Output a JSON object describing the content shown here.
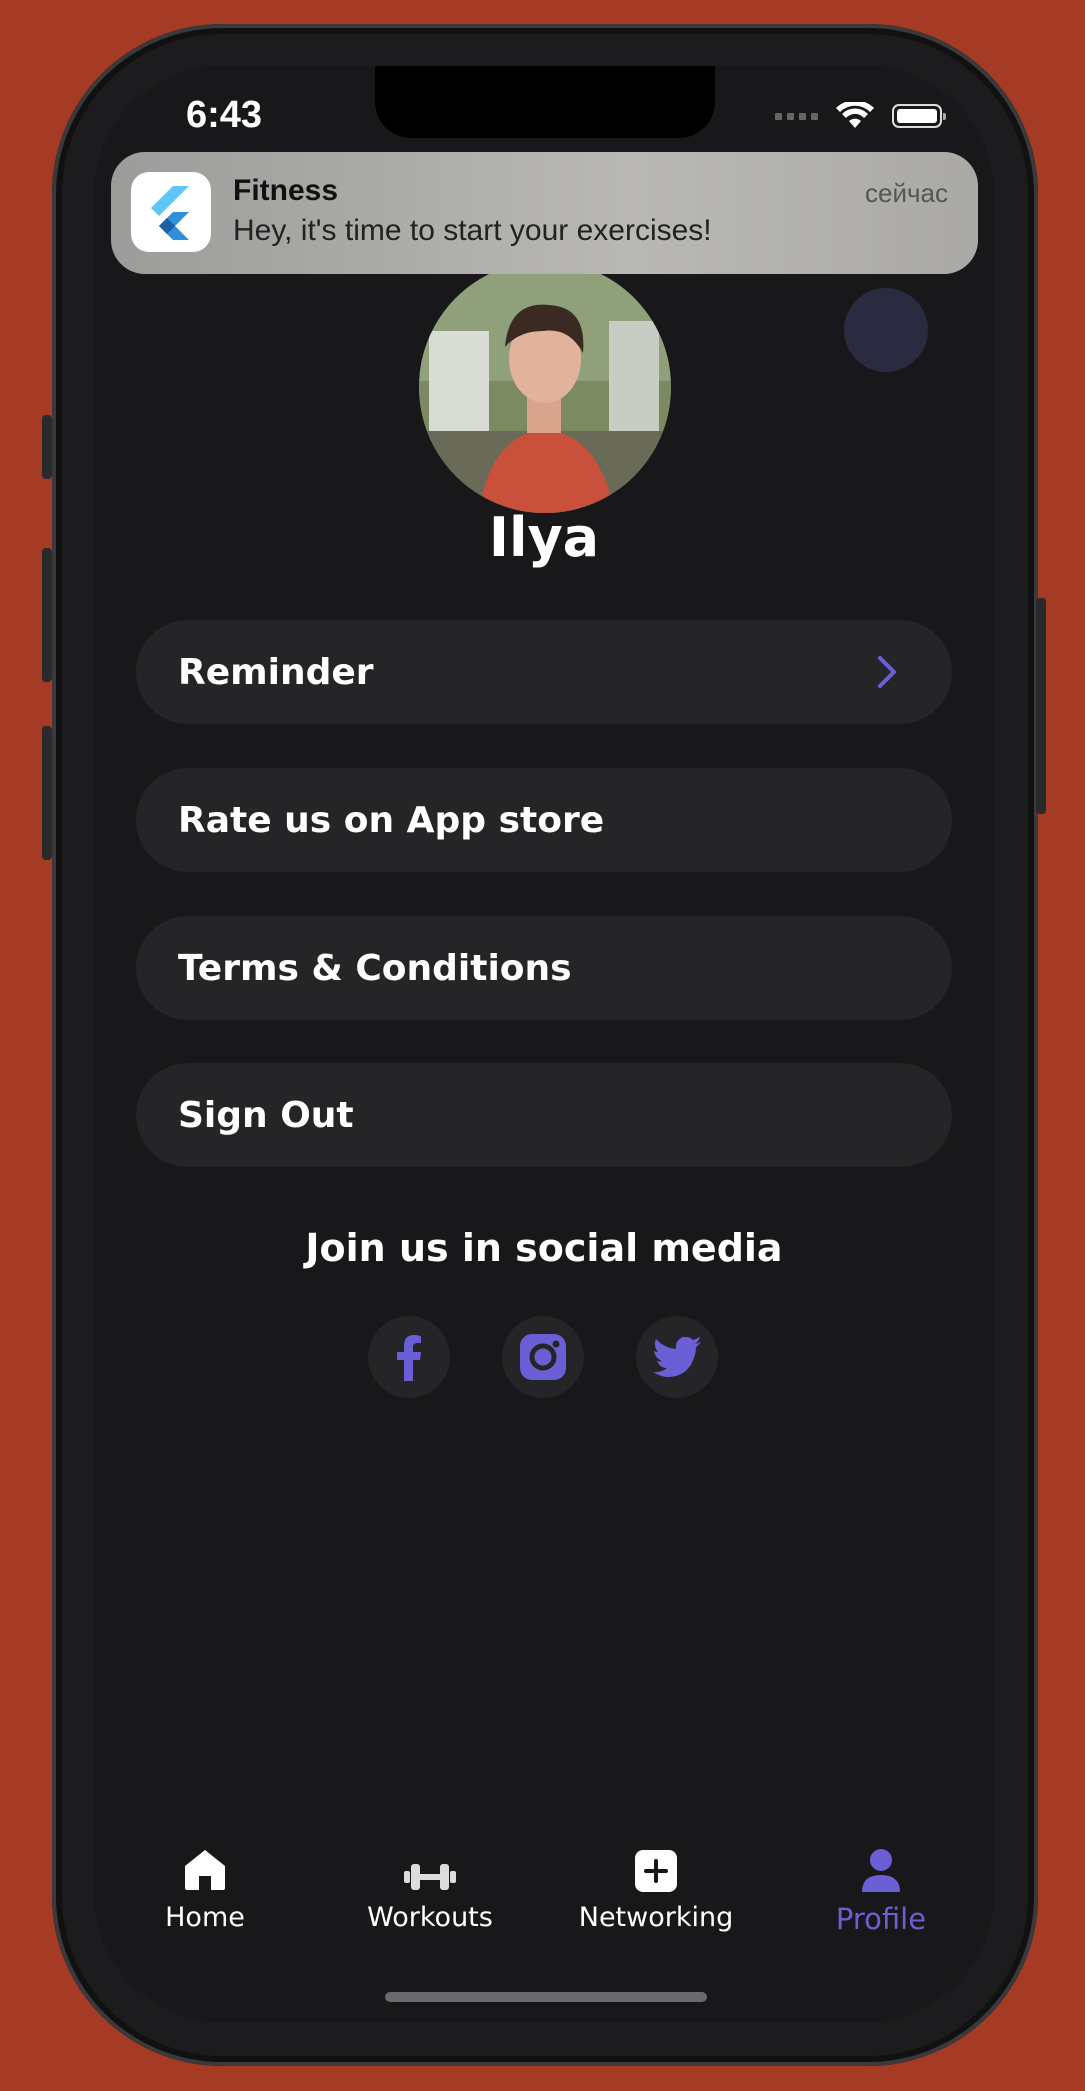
{
  "status_bar": {
    "time": "6:43"
  },
  "notification": {
    "app_name": "Fitness",
    "message": "Hey, it's time to start your exercises!",
    "time": "сейчас"
  },
  "profile": {
    "name": "Ilya"
  },
  "menu": [
    {
      "label": "Reminder",
      "has_chevron": true
    },
    {
      "label": "Rate us on App store",
      "has_chevron": false
    },
    {
      "label": "Terms & Conditions",
      "has_chevron": false
    },
    {
      "label": "Sign Out",
      "has_chevron": false
    }
  ],
  "social": {
    "title": "Join us in social media",
    "icons": [
      "facebook-icon",
      "instagram-icon",
      "twitter-icon"
    ]
  },
  "tabbar": [
    {
      "label": "Home",
      "icon": "home-icon",
      "active": false
    },
    {
      "label": "Workouts",
      "icon": "dumbbell-icon",
      "active": false
    },
    {
      "label": "Networking",
      "icon": "plus-square-icon",
      "active": false
    },
    {
      "label": "Profile",
      "icon": "person-icon",
      "active": true
    }
  ],
  "colors": {
    "accent": "#6b5fd6",
    "background": "#18181a",
    "card": "#252527",
    "page_background": "#a63b25"
  }
}
